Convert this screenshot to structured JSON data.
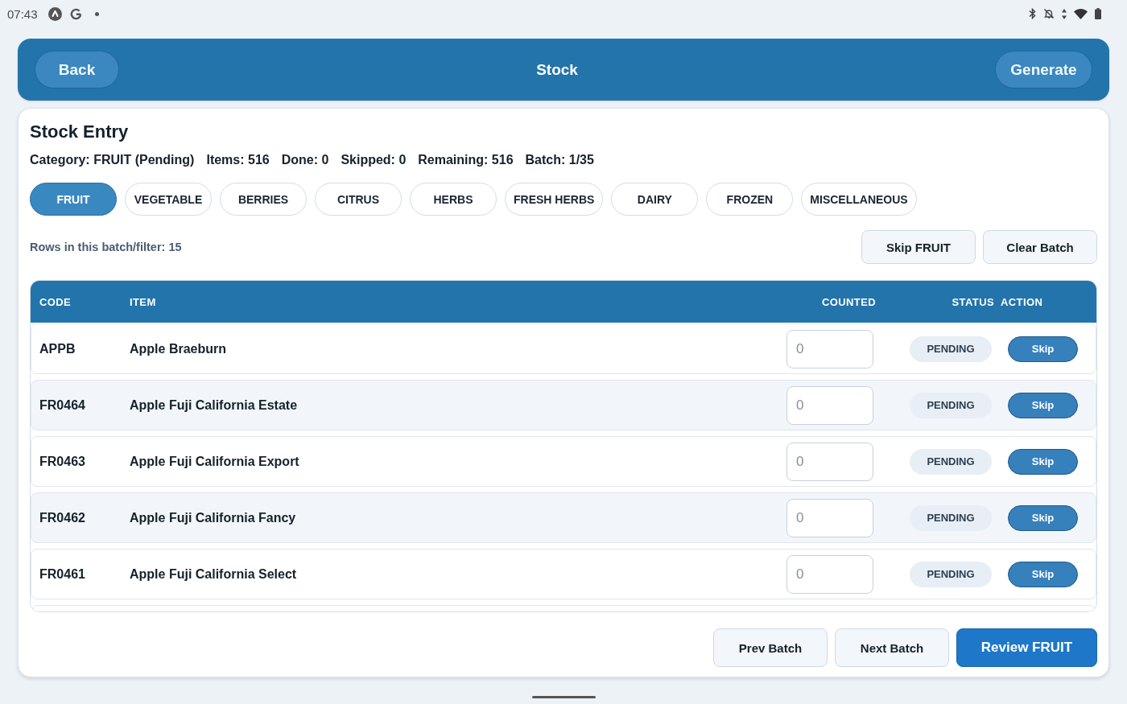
{
  "status_bar": {
    "time": "07:43"
  },
  "header": {
    "back_button": "Back",
    "title": "Stock",
    "generate_button": "Generate"
  },
  "stock_entry": {
    "title": "Stock Entry",
    "summary": [
      "Category: FRUIT (Pending)",
      "Items: 516",
      "Done: 0",
      "Skipped: 0",
      "Remaining: 516",
      "Batch: 1/35"
    ],
    "category_tabs": [
      {
        "label": "FRUIT",
        "selected": true
      },
      {
        "label": "VEGETABLE",
        "selected": false
      },
      {
        "label": "BERRIES",
        "selected": false
      },
      {
        "label": "CITRUS",
        "selected": false
      },
      {
        "label": "HERBS",
        "selected": false
      },
      {
        "label": "FRESH HERBS",
        "selected": false
      },
      {
        "label": "DAIRY",
        "selected": false
      },
      {
        "label": "FROZEN",
        "selected": false
      },
      {
        "label": "MISCELLANEOUS",
        "selected": false
      }
    ],
    "rows_info": "Rows in this batch/filter: 15",
    "batch_actions": [
      "Skip FRUIT",
      "Clear Batch"
    ],
    "table": {
      "columns": [
        "CODE",
        "ITEM",
        "COUNTED",
        "STATUS",
        "ACTION"
      ],
      "rows": [
        {
          "code": "APPB",
          "item": "Apple Braeburn",
          "counted": {
            "placeholder": "0"
          },
          "status": "PENDING",
          "action": "Skip"
        },
        {
          "code": "FR0464",
          "item": "Apple Fuji California Estate",
          "counted": {
            "placeholder": "0"
          },
          "status": "PENDING",
          "action": "Skip"
        },
        {
          "code": "FR0463",
          "item": "Apple Fuji California Export",
          "counted": {
            "placeholder": "0"
          },
          "status": "PENDING",
          "action": "Skip"
        },
        {
          "code": "FR0462",
          "item": "Apple Fuji California Fancy",
          "counted": {
            "placeholder": "0"
          },
          "status": "PENDING",
          "action": "Skip"
        },
        {
          "code": "FR0461",
          "item": "Apple Fuji California Select",
          "counted": {
            "placeholder": "0"
          },
          "status": "PENDING",
          "action": "Skip"
        }
      ]
    },
    "footer_buttons": [
      {
        "label": "Prev Batch",
        "kind": "secondary"
      },
      {
        "label": "Next Batch",
        "kind": "secondary"
      },
      {
        "label": "Review FRUIT",
        "kind": "primary"
      }
    ]
  }
}
